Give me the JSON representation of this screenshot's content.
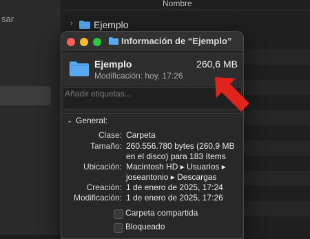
{
  "background": {
    "sidebar_partial_text": "sar",
    "column_header": "Nombre",
    "row_name": "Ejemplo"
  },
  "window": {
    "title": "Información de “Ejemplo”",
    "name": "Ejemplo",
    "size": "260,6 MB",
    "modified": "Modificación: hoy, 17:26",
    "tags_placeholder": "Añadir etiquetas...",
    "general_label": "General:",
    "rows": [
      {
        "label": "Clase:",
        "value": "Carpeta"
      },
      {
        "label": "Tamaño:",
        "value": "260.556.780 bytes (260,9 MB",
        "value2": "en el disco) para 183 ítems"
      },
      {
        "label": "Ubicación:",
        "value": "Macintosh HD ▸ Usuarios ▸",
        "value2": "joseantonio ▸ Descargas"
      },
      {
        "label": "Creación:",
        "value": "1 de enero de 2025, 17:24"
      },
      {
        "label": "Modificación:",
        "value": "1 de enero de 2025, 17:26"
      }
    ],
    "checkboxes": [
      {
        "label": "Carpeta compartida",
        "checked": false
      },
      {
        "label": "Bloqueado",
        "checked": false
      }
    ]
  },
  "colors": {
    "folder": "#5aa9f0",
    "arrow": "#e0231b",
    "close": "#ff5f57",
    "minimize": "#febc2e",
    "zoom": "#28c840"
  },
  "icons": [
    "folder-icon",
    "chevron-right-icon",
    "chevron-down-icon",
    "red-arrow-annotation"
  ]
}
